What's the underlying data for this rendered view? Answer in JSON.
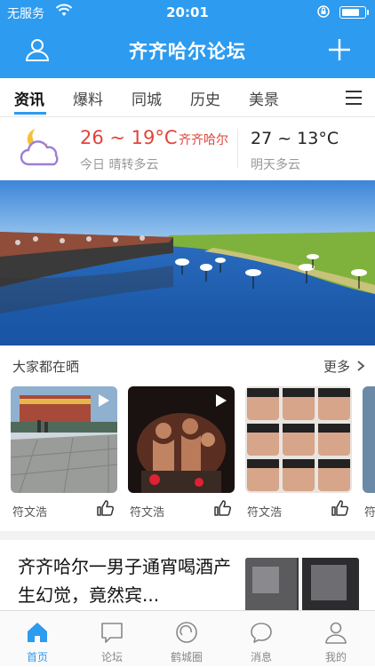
{
  "status_bar": {
    "carrier": "无服务",
    "time": "20:01",
    "battery_level": 0.85
  },
  "nav": {
    "title": "齐齐哈尔论坛"
  },
  "tabs": [
    {
      "label": "资讯",
      "active": true
    },
    {
      "label": "爆料",
      "active": false
    },
    {
      "label": "同城",
      "active": false
    },
    {
      "label": "历史",
      "active": false
    },
    {
      "label": "美景",
      "active": false
    }
  ],
  "weather": {
    "today_temp": "26 ~ 19°C",
    "city": "齐齐哈尔",
    "today_desc": "今日 晴转多云",
    "tomorrow_temp": "27 ~ 13°C",
    "tomorrow_desc": "明天多云"
  },
  "share": {
    "label": "大家都在晒",
    "more": "更多",
    "cards": [
      {
        "author": "符文浩"
      },
      {
        "author": "符文浩"
      },
      {
        "author": "符文浩"
      },
      {
        "author": "符"
      }
    ]
  },
  "news": {
    "headline": "齐齐哈尔一男子通宵喝酒产生幻觉，竟然宾..."
  },
  "bottom_nav": [
    {
      "label": "首页",
      "icon": "home-icon",
      "active": true
    },
    {
      "label": "论坛",
      "icon": "forum-icon",
      "active": false
    },
    {
      "label": "鹤城圈",
      "icon": "circle-icon",
      "active": false
    },
    {
      "label": "消息",
      "icon": "message-icon",
      "active": false
    },
    {
      "label": "我的",
      "icon": "profile-icon",
      "active": false
    }
  ],
  "colors": {
    "brand": "#2d9bf0",
    "temp_red": "#e0443a",
    "inactive": "#888888"
  }
}
